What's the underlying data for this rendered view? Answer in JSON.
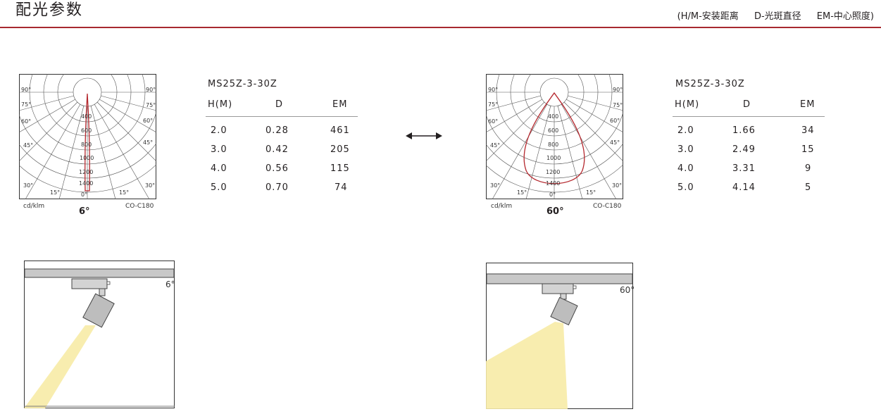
{
  "header": {
    "title": "配光参数",
    "legend": [
      "(H/M-安装距离",
      "D-光斑直径",
      "EM-中心照度)"
    ]
  },
  "polar_common": {
    "unit": "cd/klm",
    "plane": "CO-C180",
    "angles": {
      "a90": "90°",
      "a75": "75°",
      "a60": "60°",
      "a45": "45°",
      "a30": "30°",
      "a15": "15°",
      "a0": "0°"
    },
    "radial": [
      "400",
      "600",
      "800",
      "1000",
      "1200",
      "1400"
    ]
  },
  "left": {
    "beam_angle": "6°",
    "model": "MS25Z-3-30Z",
    "columns": [
      "H(M)",
      "D",
      "EM"
    ],
    "rows": [
      [
        "2.0",
        "0.28",
        "461"
      ],
      [
        "3.0",
        "0.42",
        "205"
      ],
      [
        "4.0",
        "0.56",
        "115"
      ],
      [
        "5.0",
        "0.70",
        "74"
      ]
    ],
    "scene_label": "6°"
  },
  "right": {
    "beam_angle": "60°",
    "model": "MS25Z-3-30Z",
    "columns": [
      "H(M)",
      "D",
      "EM"
    ],
    "rows": [
      [
        "2.0",
        "1.66",
        "34"
      ],
      [
        "3.0",
        "2.49",
        "15"
      ],
      [
        "4.0",
        "3.31",
        "9"
      ],
      [
        "5.0",
        "4.14",
        "5"
      ]
    ],
    "scene_label": "60°"
  },
  "colors": {
    "accent": "#a8292f",
    "curve": "#b5282e",
    "beam": "#f7eba6"
  },
  "icons": {
    "compare": "double-arrow-icon"
  }
}
